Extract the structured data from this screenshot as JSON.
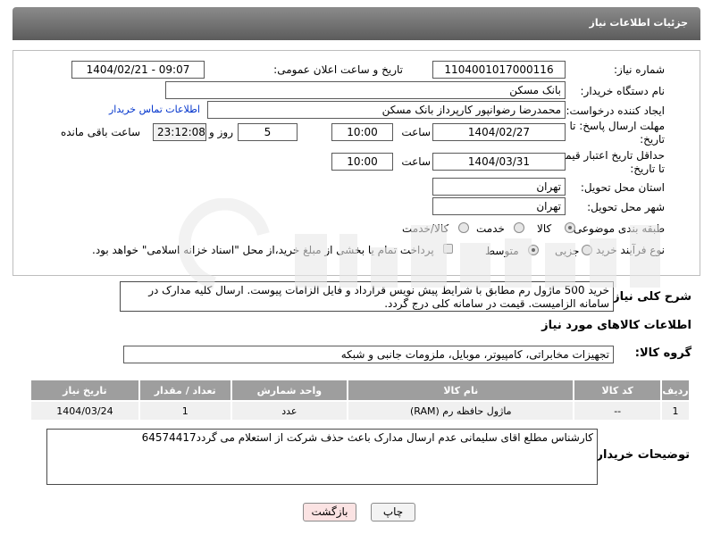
{
  "header": {
    "title": "جزئیات اطلاعات نیاز"
  },
  "form": {
    "need_number_label": "شماره نیاز:",
    "need_number": "1104001017000116",
    "announce_label": "تاریخ و ساعت اعلان عمومی:",
    "announce_value": "1404/02/21 - 09:07",
    "buyer_org_label": "نام دستگاه خریدار:",
    "buyer_org": "بانک مسکن",
    "creator_label": "ایجاد کننده درخواست:",
    "creator": "محمدرضا رضوانپور کارپرداز بانک مسکن",
    "contact_link": "اطلاعات تماس خریدار",
    "deadline_label_1": "مهلت ارسال پاسخ: تا",
    "deadline_label_2": "تاریخ:",
    "deadline_date": "1404/02/27",
    "time_word": "ساعت",
    "deadline_time": "10:00",
    "days_value": "5",
    "days_word": "روز و",
    "remaining_value": "23:12:08",
    "remaining_word": "ساعت باقی مانده",
    "validity_label_1": "حداقل تاریخ اعتبار قیمت:",
    "validity_label_2": "تا تاریخ:",
    "validity_date": "1404/03/31",
    "validity_time": "10:00",
    "province_label": "استان محل تحویل:",
    "province": "تهران",
    "city_label": "شهر محل تحویل:",
    "city": "تهران",
    "category_label": "طبقه بندی موضوعی:",
    "category_options": [
      "کالا",
      "خدمت",
      "کالا/خدمت"
    ],
    "category_selected": "کالا",
    "process_label": "نوع فرآیند خرید :",
    "process_options": [
      "جزیی",
      "متوسط"
    ],
    "process_selected": "متوسط",
    "payment_note": "پرداخت تمام یا بخشی از مبلغ خرید،از محل \"اسناد خزانه اسلامی\" خواهد بود."
  },
  "description": {
    "label": "شرح کلی نیاز:",
    "text": "خرید 500 ماژول رم مطابق با شرایط پیش نویس قرارداد و فایل الزامات پیوست. ارسال کلیه مدارک در سامانه الزامیست. قیمت در سامانه کلی درج گردد."
  },
  "goods_section": {
    "title": "اطلاعات کالاهای مورد نیاز",
    "group_label": "گروه کالا:",
    "group_value": "تجهیزات مخابراتی، کامپیوتر، موبایل، ملزومات جانبی و شبکه"
  },
  "table": {
    "headers": [
      "ردیف",
      "کد کالا",
      "نام کالا",
      "واحد شمارش",
      "تعداد / مقدار",
      "تاریخ نیاز"
    ],
    "rows": [
      [
        "1",
        "--",
        "ماژول حافظه رم (RAM)",
        "عدد",
        "1",
        "1404/03/24"
      ]
    ]
  },
  "buyer_notes": {
    "label": "توضیحات خریدار:",
    "text": "کارشناس مطلع اقای سلیمانی  عدم ارسال مدارک باعث حذف شرکت از استعلام می گردد64574417"
  },
  "buttons": {
    "print": "چاپ",
    "back": "بازگشت"
  },
  "colors": {
    "header_bg": "#7a7a7a",
    "table_header": "#9e9e9e",
    "link": "#0033cc",
    "back_button": "#fbe3e3"
  }
}
